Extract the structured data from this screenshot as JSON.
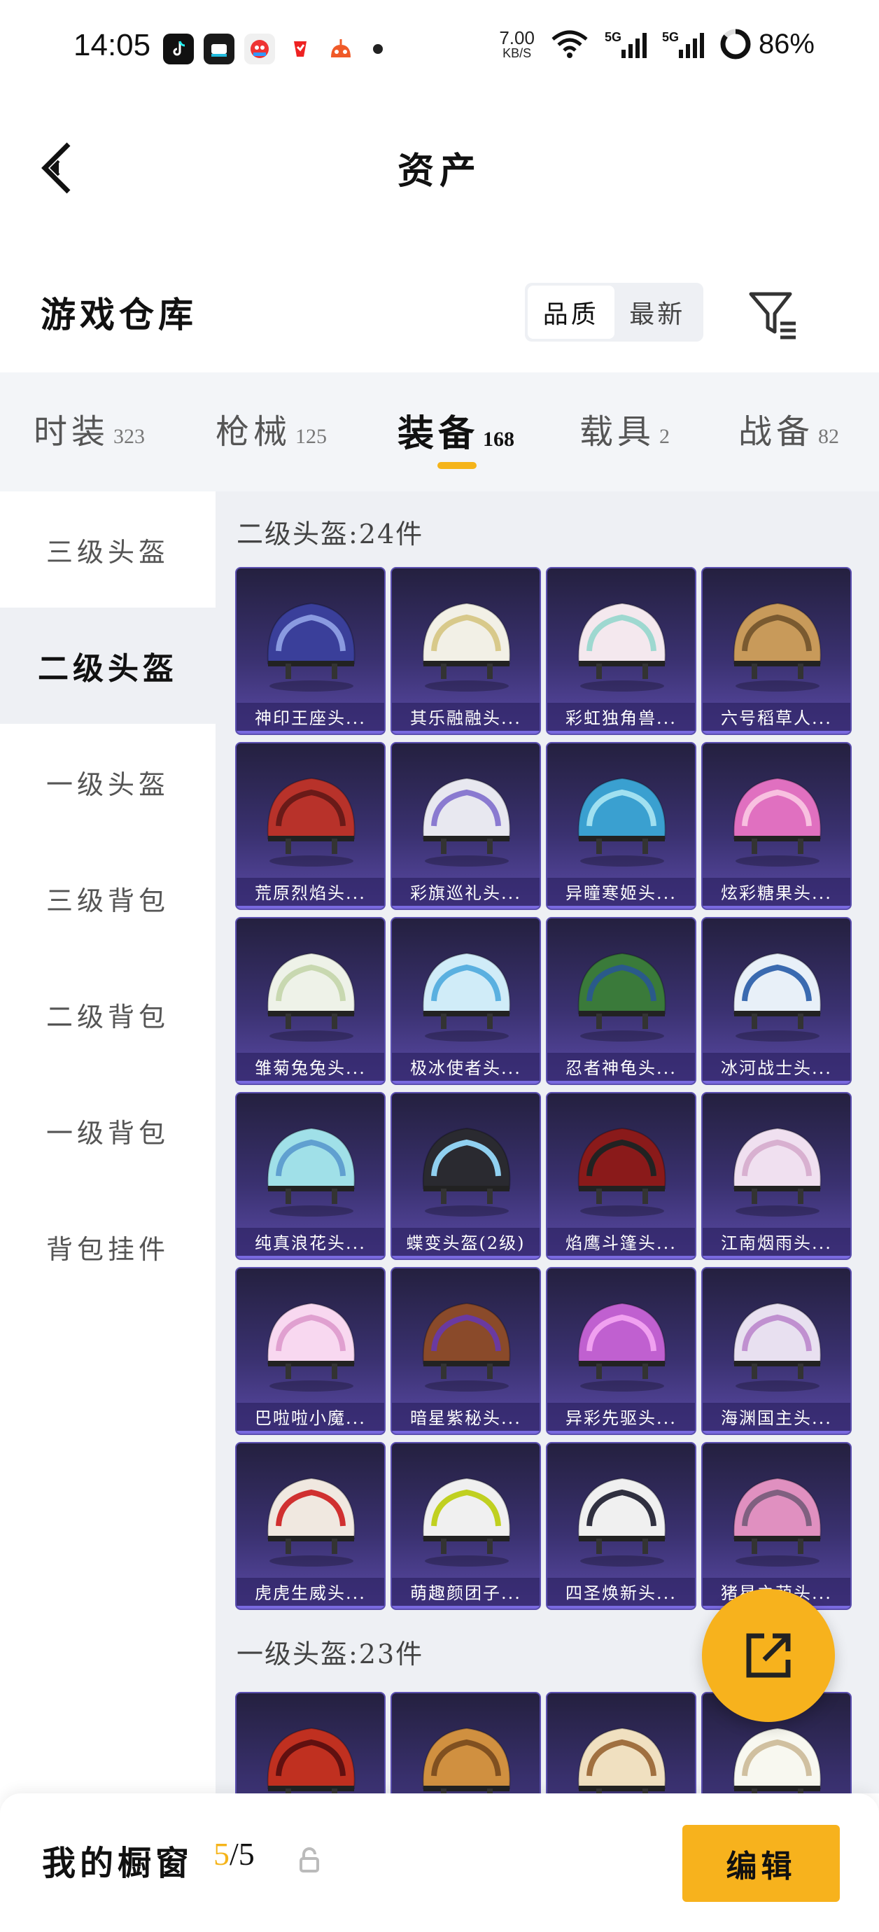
{
  "status_bar": {
    "time": "14:05",
    "net_speed_value": "7.00",
    "net_speed_unit": "KB/S",
    "battery": "86%",
    "apps": [
      "tiktok-icon",
      "video-app-icon",
      "game-app-icon",
      "shop-app-icon",
      "robot-app-icon"
    ]
  },
  "header": {
    "title": "资产"
  },
  "warehouse": {
    "title": "游戏仓库",
    "sort_options": [
      {
        "label": "品质",
        "active": true
      },
      {
        "label": "最新",
        "active": false
      }
    ]
  },
  "tabs": [
    {
      "label": "时装",
      "count": "323"
    },
    {
      "label": "枪械",
      "count": "125"
    },
    {
      "label": "装备",
      "count": "168",
      "active": true
    },
    {
      "label": "载具",
      "count": "2"
    },
    {
      "label": "战备",
      "count": "82"
    }
  ],
  "sidebar": [
    {
      "label": "三级头盔"
    },
    {
      "label": "二级头盔",
      "active": true
    },
    {
      "label": "一级头盔"
    },
    {
      "label": "三级背包"
    },
    {
      "label": "二级背包"
    },
    {
      "label": "一级背包"
    },
    {
      "label": "背包挂件"
    }
  ],
  "sections": [
    {
      "title": "二级头盔:24件",
      "items": [
        "神印王座头...",
        "其乐融融头...",
        "彩虹独角兽...",
        "六号稻草人...",
        "荒原烈焰头...",
        "彩旗巡礼头...",
        "异瞳寒姬头...",
        "炫彩糖果头...",
        "雏菊兔兔头...",
        "极冰使者头...",
        "忍者神龟头...",
        "冰河战士头...",
        "纯真浪花头...",
        "蝶变头盔(2级)",
        "焰鹰斗篷头...",
        "江南烟雨头...",
        "巴啦啦小魔...",
        "暗星紫秘头...",
        "异彩先驱头...",
        "海渊国主头...",
        "虎虎生威头...",
        "萌趣颜团子...",
        "四圣焕新头...",
        "猪星之萌头..."
      ]
    },
    {
      "title": "一级头盔:23件",
      "items": [
        "",
        "",
        "",
        ""
      ]
    }
  ],
  "bottom_bar": {
    "title": "我的橱窗",
    "current": "5",
    "total": "/5",
    "edit_label": "编辑"
  },
  "colors": {
    "accent": "#f5b41a",
    "card_bg": "#3a3170",
    "panel_bg": "#eef0f4"
  }
}
